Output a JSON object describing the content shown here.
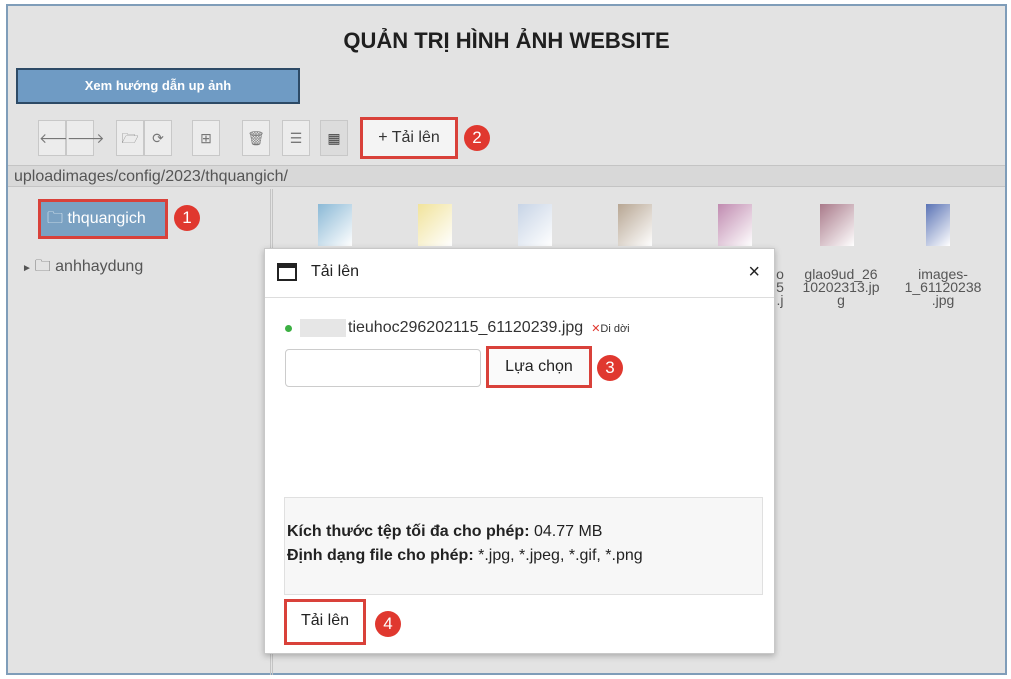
{
  "header": {
    "title": "QUẢN TRỊ HÌNH ẢNH WEBSITE",
    "guide_button": "Xem hướng dẫn up ảnh"
  },
  "toolbar": {
    "buttons": [
      {
        "icon": "back-arrow-icon",
        "glyph": "🡐"
      },
      {
        "icon": "forward-arrow-icon",
        "glyph": "🡒"
      },
      {
        "icon": "open-folder-icon",
        "glyph": "🗁"
      },
      {
        "icon": "refresh-icon",
        "glyph": "⟳"
      },
      {
        "icon": "new-folder-icon",
        "glyph": "⊞"
      },
      {
        "icon": "trash-icon",
        "glyph": "🗑"
      },
      {
        "icon": "list-view-icon",
        "glyph": "☰"
      },
      {
        "icon": "grid-view-icon",
        "glyph": "▦"
      }
    ],
    "upload_label": "+ Tải lên"
  },
  "path": "uploadimages/config/2023/thquangich/",
  "tree": {
    "selected": "thquangich",
    "other": "anhhaydung"
  },
  "files": [
    {
      "label": "",
      "color": "#8bb9d6"
    },
    {
      "label": "",
      "color": "#f1e39b"
    },
    {
      "label": "",
      "color": "#c7d4e6"
    },
    {
      "label": "",
      "color": "#b7a693"
    },
    {
      "label": "",
      "color": "#c08bb0"
    },
    {
      "label": "glao9ud_26\n10202313.jp\ng",
      "color": "#a97a8a"
    },
    {
      "label": "images-\n1_61120238\n.jpg",
      "color": "#5a73b5"
    }
  ],
  "partial_label": "o\n5\n.j",
  "badges": [
    "1",
    "2",
    "3",
    "4"
  ],
  "modal": {
    "title": "Tải lên",
    "close": "×",
    "file_name": "tieuhoc296202115_61120239.jpg",
    "remove_label": "Di dời",
    "choose_button": "Lựa chọn",
    "max_size_label": "Kích thước tệp tối đa cho phép:",
    "max_size_value": "04.77 MB",
    "formats_label": "Định dạng file cho phép:",
    "formats_value": "*.jpg, *.jpeg, *.gif, *.png",
    "submit_button": "Tải lên"
  }
}
